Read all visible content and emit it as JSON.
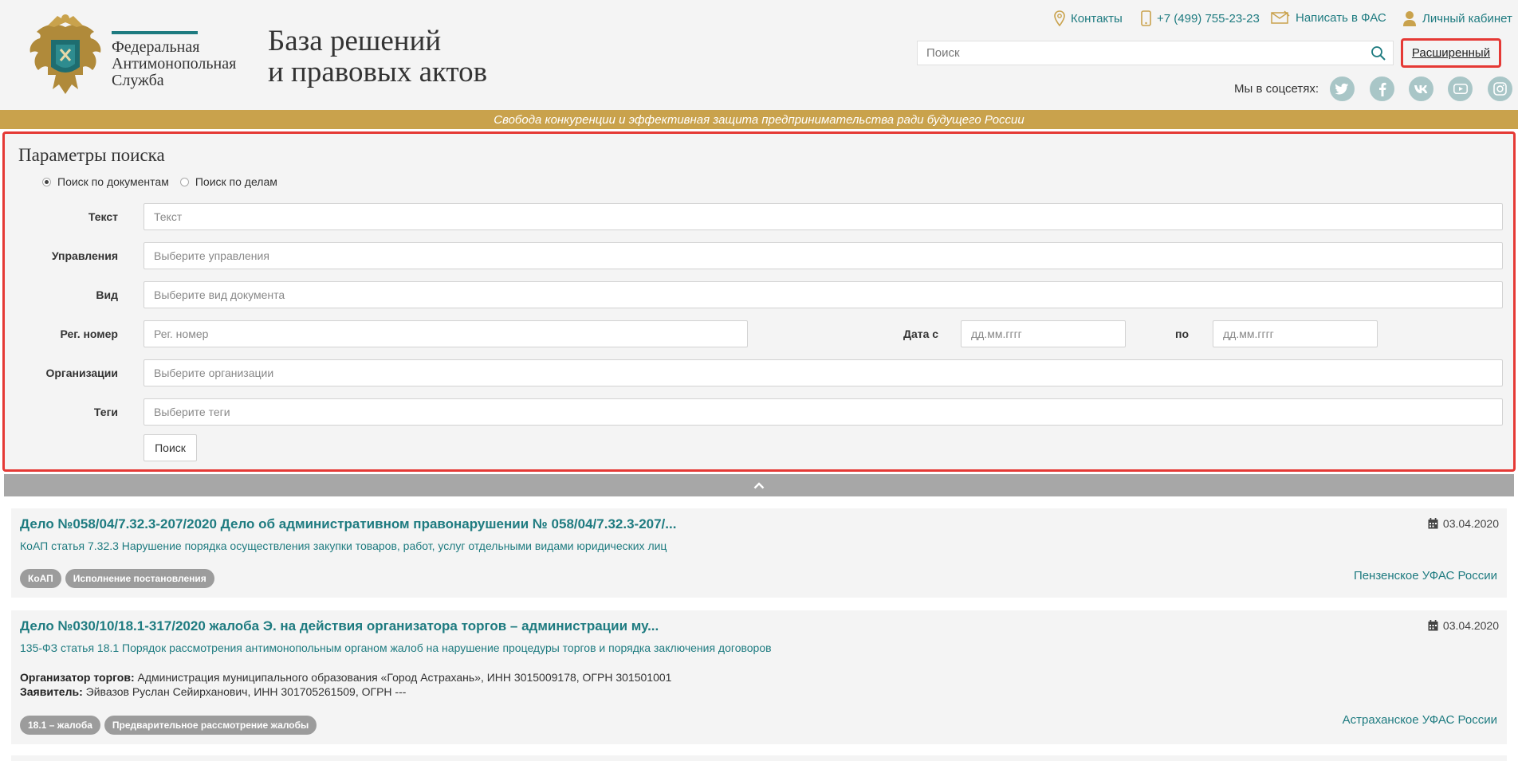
{
  "header": {
    "agency_lines": [
      "Федеральная",
      "Антимонопольная",
      "Служба"
    ],
    "title_lines": [
      "База решений",
      "и правовых актов"
    ],
    "links": [
      {
        "label": "Контакты",
        "icon": "map-pin-icon"
      },
      {
        "label": "+7 (499) 755-23-23",
        "icon": "phone-icon"
      },
      {
        "label": "Написать в ФАС",
        "icon": "envelope-icon"
      },
      {
        "label": "Личный кабинет",
        "icon": "user-icon"
      }
    ],
    "search_placeholder": "Поиск",
    "advanced_label": "Расширенный",
    "social_label": "Мы в соцсетях:",
    "social_icons": [
      "twitter-icon",
      "facebook-icon",
      "vk-icon",
      "youtube-icon",
      "instagram-icon"
    ],
    "motto": "Свобода конкуренции и эффективная защита предпринимательства ради будущего России"
  },
  "params": {
    "title": "Параметры поиска",
    "mode_options": [
      {
        "label": "Поиск по документам",
        "checked": true
      },
      {
        "label": "Поиск по делам",
        "checked": false
      }
    ],
    "text_label": "Текст",
    "text_placeholder": "Текст",
    "dept_label": "Управления",
    "dept_placeholder": "Выберите управления",
    "kind_label": "Вид",
    "kind_placeholder": "Выберите вид документа",
    "reg_label": "Рег. номер",
    "reg_placeholder": "Рег. номер",
    "date_from_label": "Дата с",
    "date_from_placeholder": "дд.мм.гггг",
    "date_to_label": "по",
    "date_to_placeholder": "дд.мм.гггг",
    "org_label": "Организации",
    "org_placeholder": "Выберите организации",
    "tags_label": "Теги",
    "tags_placeholder": "Выберите теги",
    "submit_label": "Поиск"
  },
  "results": [
    {
      "title": "Дело №058/04/7.32.3-207/2020 Дело об административном правонарушении № 058/04/7.32.3-207/...",
      "subtitle": "КоАП статья 7.32.3 Нарушение порядка осуществления закупки товаров, работ, услуг отдельными видами юридических лиц",
      "date": "03.04.2020",
      "tags": [
        "КоАП",
        "Исполнение постановления"
      ],
      "org": "Пензенское УФАС России"
    },
    {
      "title": "Дело №030/10/18.1-317/2020 жалоба Э. на действия организатора торгов – администрации му...",
      "subtitle": "135-ФЗ статья 18.1 Порядок рассмотрения антимонопольным органом жалоб на нарушение процедуры торгов и порядка заключения договоров",
      "date": "03.04.2020",
      "info": [
        {
          "key": "Организатор торгов",
          "value": "Администрация муниципального образования «Город Астрахань», ИНН 3015009178, ОГРН 301501001"
        },
        {
          "key": "Заявитель",
          "value": "Эйвазов Руслан Сейирханович, ИНН 301705261509, ОГРН ---"
        }
      ],
      "tags": [
        "18.1 – жалоба",
        "Предварительное рассмотрение жалобы"
      ],
      "org": "Астраханское УФАС России"
    }
  ],
  "colors": {
    "accent": "#1e7b80",
    "gold": "#c9a24c",
    "highlight": "#e53935",
    "tag_bg": "#9c9c9c"
  }
}
